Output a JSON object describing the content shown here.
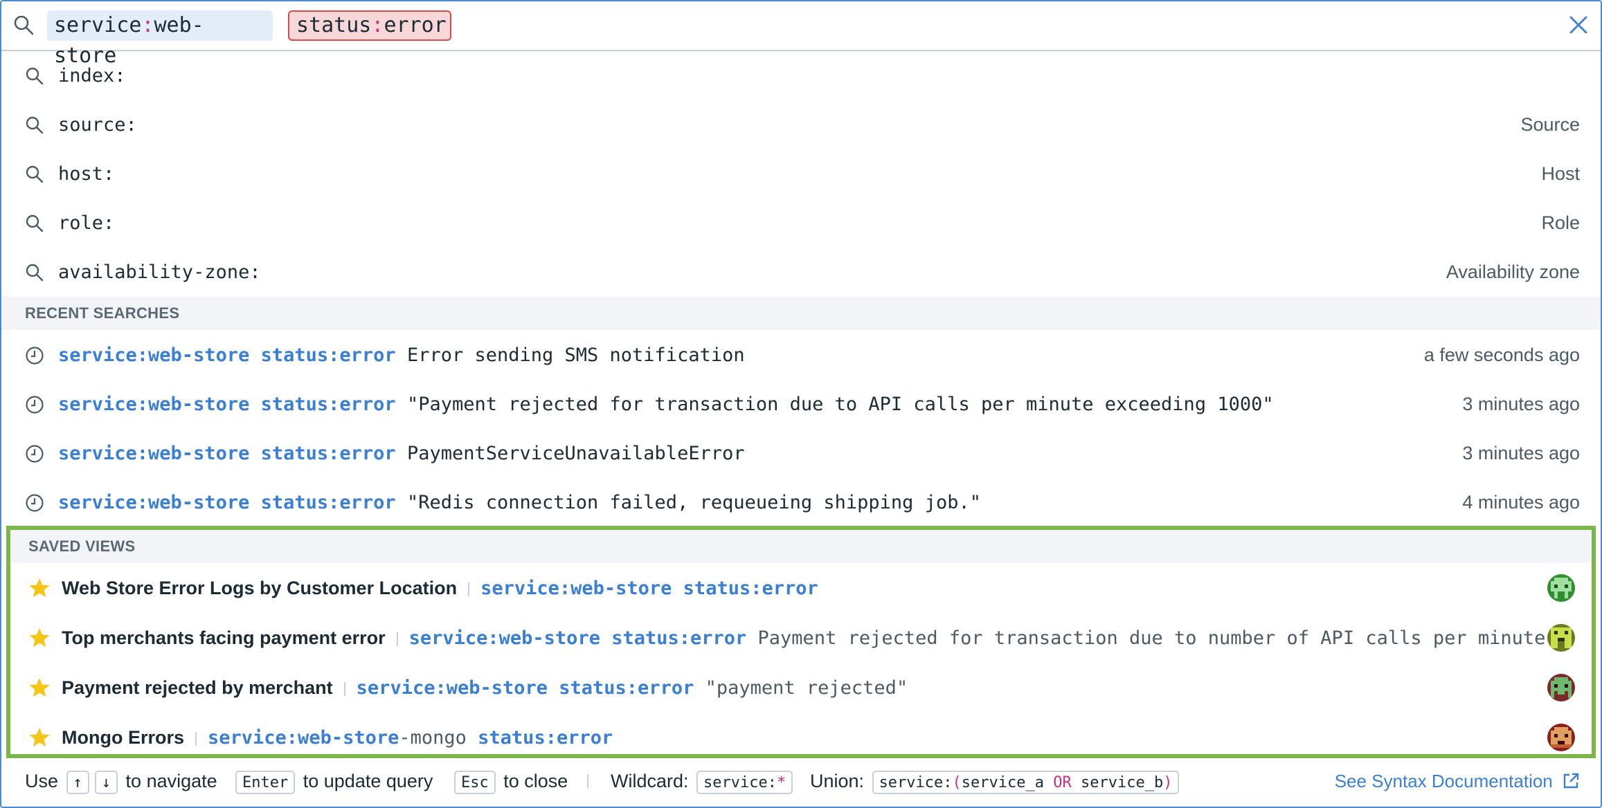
{
  "search": {
    "chips": [
      {
        "key": "service",
        "colon": ":",
        "value": "web-store"
      },
      {
        "key": "status",
        "colon": ":",
        "value": "error"
      }
    ]
  },
  "suggestions": [
    {
      "text": "index:",
      "hint": ""
    },
    {
      "text": "source:",
      "hint": "Source"
    },
    {
      "text": "host:",
      "hint": "Host"
    },
    {
      "text": "role:",
      "hint": "Role"
    },
    {
      "text": "availability-zone:",
      "hint": "Availability zone"
    }
  ],
  "recent": {
    "title": "RECENT SEARCHES",
    "items": [
      {
        "query": "service:web-store status:error",
        "text": "Error sending SMS notification",
        "time": "a few seconds ago"
      },
      {
        "query": "service:web-store status:error",
        "text": "\"Payment rejected for transaction due to API calls per minute exceeding 1000\"",
        "time": "3 minutes ago"
      },
      {
        "query": "service:web-store status:error",
        "text": "PaymentServiceUnavailableError",
        "time": "3 minutes ago"
      },
      {
        "query": "service:web-store status:error",
        "text": "\"Redis connection failed, requeueing shipping job.\"",
        "time": "4 minutes ago"
      }
    ]
  },
  "saved": {
    "title": "SAVED VIEWS",
    "items": [
      {
        "name": "Web Store Error Logs by Customer Location",
        "q1": "service:web-store",
        "mid": "",
        "q2": " status:error",
        "rest": ""
      },
      {
        "name": "Top merchants facing payment error",
        "q1": "service:web-store",
        "mid": "",
        "q2": " status:error",
        "rest": " Payment rejected for transaction due to number of API calls per minute …"
      },
      {
        "name": "Payment rejected by merchant",
        "q1": "service:web-store",
        "mid": "",
        "q2": " status:error",
        "rest": " \"payment rejected\""
      },
      {
        "name": "Mongo Errors",
        "q1": "service:web-store",
        "mid": "-mongo",
        "q2": " status:error",
        "rest": ""
      }
    ]
  },
  "footer": {
    "use": "Use",
    "up_key": "↑",
    "down_key": "↓",
    "navigate": "to navigate",
    "enter_key": "Enter",
    "update": "to update query",
    "esc_key": "Esc",
    "close": "to close",
    "wildcard_label": "Wildcard:",
    "wildcard_key": "service:",
    "wildcard_star": "*",
    "union_label": "Union:",
    "union_a": "service:",
    "union_b": "(",
    "union_c": "service_a ",
    "union_or": "OR",
    "union_d": " service_b",
    "union_e": ")",
    "doc_link": "See Syntax Documentation"
  },
  "colors": {
    "accent": "#3a7fd2",
    "saved_border": "#7ab648",
    "error_chip": "#d44b4b",
    "star": "#f5c518"
  }
}
